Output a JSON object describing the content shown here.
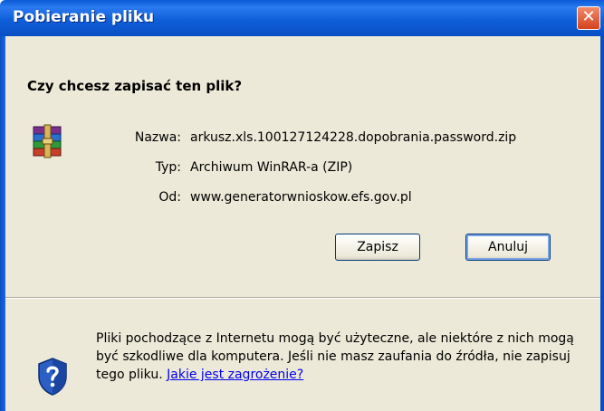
{
  "window": {
    "title": "Pobieranie pliku",
    "close_glyph": "✕"
  },
  "dialog": {
    "question": "Czy chcesz zapisać ten plik?",
    "file_icon": "winrar-archive-icon",
    "fields": [
      {
        "label": "Nazwa:",
        "value": "arkusz.xls.100127124228.dopobrania.password.zip"
      },
      {
        "label": "Typ:",
        "value": "Archiwum WinRAR-a (ZIP)"
      },
      {
        "label": "Od:",
        "value": "www.generatorwnioskow.efs.gov.pl"
      }
    ],
    "buttons": {
      "save": "Zapisz",
      "cancel": "Anuluj"
    }
  },
  "warning": {
    "icon": "security-shield-question-icon",
    "text": "Pliki pochodzące z Internetu mogą być użyteczne, ale niektóre z nich mogą być szkodliwe dla komputera. Jeśli nie masz zaufania do źródła, nie zapisuj tego pliku.",
    "link": "Jakie jest zagrożenie?"
  },
  "colors": {
    "titlebar": "#0a5ad8",
    "dialog_bg": "#ece9d8",
    "link": "#0000ee"
  }
}
